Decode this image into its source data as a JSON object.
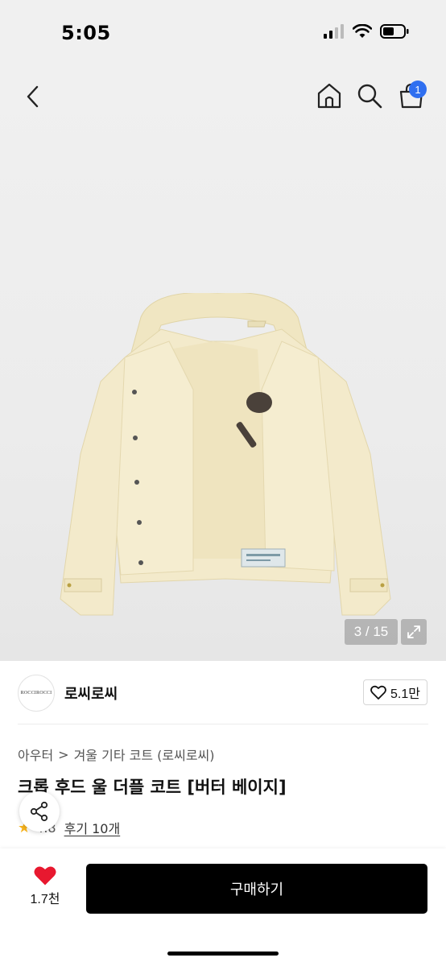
{
  "status_bar": {
    "time": "5:05"
  },
  "nav": {
    "cart_badge": "1"
  },
  "gallery": {
    "counter": "3 / 15",
    "thumb_arrow": "›"
  },
  "brand": {
    "logo_text": "ROCCIROCCI",
    "name": "로씨로씨",
    "likes": "5.1만"
  },
  "breadcrumb": {
    "items": [
      "아우터",
      "겨울 기타 코트 (로씨로씨)"
    ],
    "separator": ">"
  },
  "product": {
    "title": "크롭 후드 울 더플 코트 [버터 베이지]",
    "rating": "4.8",
    "reviews": "후기 10개"
  },
  "bottom_bar": {
    "wish_count": "1.7천",
    "buy_label": "구매하기"
  },
  "colors": {
    "accent": "#2f6ff0",
    "heart": "#e8182f",
    "star": "#f7b31c",
    "coat": "#f1e8c6"
  },
  "icons": [
    "back-icon",
    "home-icon",
    "search-icon",
    "cart-icon",
    "expand-icon",
    "heart-outline-icon",
    "share-icon",
    "heart-filled-icon",
    "star-icon"
  ]
}
